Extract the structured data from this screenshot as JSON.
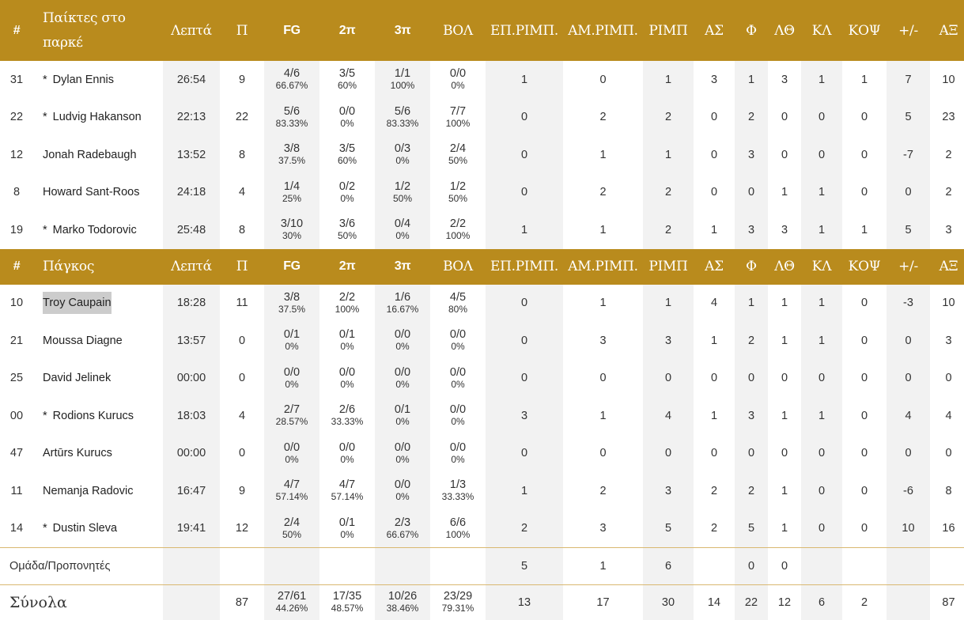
{
  "headers": {
    "starters": [
      "#",
      "Παίκτες στο παρκέ",
      "Λεπτά",
      "Π",
      "FG",
      "2π",
      "3π",
      "ΒΟΛ",
      "ΕΠ.ΡΙΜΠ.",
      "ΑΜ.ΡΙΜΠ.",
      "ΡΙΜΠ",
      "ΑΣ",
      "Φ",
      "ΛΘ",
      "ΚΛ",
      "ΚΟΨ",
      "+/-",
      "ΑΞ"
    ],
    "bench": [
      "#",
      "Πάγκος",
      "Λεπτά",
      "Π",
      "FG",
      "2π",
      "3π",
      "ΒΟΛ",
      "ΕΠ.ΡΙΜΠ.",
      "ΑΜ.ΡΙΜΠ.",
      "ΡΙΜΠ",
      "ΑΣ",
      "Φ",
      "ΛΘ",
      "ΚΛ",
      "ΚΟΨ",
      "+/-",
      "ΑΞ"
    ]
  },
  "starters": [
    {
      "num": "31",
      "star": "*",
      "name": "Dylan Ennis",
      "min": "26:54",
      "pts": "9",
      "fg": "4/6",
      "fg_pct": "66.67%",
      "p2": "3/5",
      "p2_pct": "60%",
      "p3": "1/1",
      "p3_pct": "100%",
      "ft": "0/0",
      "ft_pct": "0%",
      "or": "1",
      "dr": "0",
      "tr": "1",
      "as": "3",
      "f": "1",
      "lt": "3",
      "kl": "1",
      "kop": "1",
      "pm": "7",
      "ax": "10"
    },
    {
      "num": "22",
      "star": "*",
      "name": "Ludvig Hakanson",
      "min": "22:13",
      "pts": "22",
      "fg": "5/6",
      "fg_pct": "83.33%",
      "p2": "0/0",
      "p2_pct": "0%",
      "p3": "5/6",
      "p3_pct": "83.33%",
      "ft": "7/7",
      "ft_pct": "100%",
      "or": "0",
      "dr": "2",
      "tr": "2",
      "as": "0",
      "f": "2",
      "lt": "0",
      "kl": "0",
      "kop": "0",
      "pm": "5",
      "ax": "23"
    },
    {
      "num": "12",
      "star": "",
      "name": "Jonah Radebaugh",
      "min": "13:52",
      "pts": "8",
      "fg": "3/8",
      "fg_pct": "37.5%",
      "p2": "3/5",
      "p2_pct": "60%",
      "p3": "0/3",
      "p3_pct": "0%",
      "ft": "2/4",
      "ft_pct": "50%",
      "or": "0",
      "dr": "1",
      "tr": "1",
      "as": "0",
      "f": "3",
      "lt": "0",
      "kl": "0",
      "kop": "0",
      "pm": "-7",
      "ax": "2"
    },
    {
      "num": "8",
      "star": "",
      "name": "Howard Sant-Roos",
      "min": "24:18",
      "pts": "4",
      "fg": "1/4",
      "fg_pct": "25%",
      "p2": "0/2",
      "p2_pct": "0%",
      "p3": "1/2",
      "p3_pct": "50%",
      "ft": "1/2",
      "ft_pct": "50%",
      "or": "0",
      "dr": "2",
      "tr": "2",
      "as": "0",
      "f": "0",
      "lt": "1",
      "kl": "1",
      "kop": "0",
      "pm": "0",
      "ax": "2"
    },
    {
      "num": "19",
      "star": "*",
      "name": "Marko Todorovic",
      "min": "25:48",
      "pts": "8",
      "fg": "3/10",
      "fg_pct": "30%",
      "p2": "3/6",
      "p2_pct": "50%",
      "p3": "0/4",
      "p3_pct": "0%",
      "ft": "2/2",
      "ft_pct": "100%",
      "or": "1",
      "dr": "1",
      "tr": "2",
      "as": "1",
      "f": "3",
      "lt": "3",
      "kl": "1",
      "kop": "1",
      "pm": "5",
      "ax": "3"
    }
  ],
  "bench": [
    {
      "num": "10",
      "star": "",
      "name": "Troy Caupain",
      "highlight": true,
      "min": "18:28",
      "pts": "11",
      "fg": "3/8",
      "fg_pct": "37.5%",
      "p2": "2/2",
      "p2_pct": "100%",
      "p3": "1/6",
      "p3_pct": "16.67%",
      "ft": "4/5",
      "ft_pct": "80%",
      "or": "0",
      "dr": "1",
      "tr": "1",
      "as": "4",
      "f": "1",
      "lt": "1",
      "kl": "1",
      "kop": "0",
      "pm": "-3",
      "ax": "10"
    },
    {
      "num": "21",
      "star": "",
      "name": "Moussa Diagne",
      "min": "13:57",
      "pts": "0",
      "fg": "0/1",
      "fg_pct": "0%",
      "p2": "0/1",
      "p2_pct": "0%",
      "p3": "0/0",
      "p3_pct": "0%",
      "ft": "0/0",
      "ft_pct": "0%",
      "or": "0",
      "dr": "3",
      "tr": "3",
      "as": "1",
      "f": "2",
      "lt": "1",
      "kl": "1",
      "kop": "0",
      "pm": "0",
      "ax": "3"
    },
    {
      "num": "25",
      "star": "",
      "name": "David Jelinek",
      "min": "00:00",
      "pts": "0",
      "fg": "0/0",
      "fg_pct": "0%",
      "p2": "0/0",
      "p2_pct": "0%",
      "p3": "0/0",
      "p3_pct": "0%",
      "ft": "0/0",
      "ft_pct": "0%",
      "or": "0",
      "dr": "0",
      "tr": "0",
      "as": "0",
      "f": "0",
      "lt": "0",
      "kl": "0",
      "kop": "0",
      "pm": "0",
      "ax": "0"
    },
    {
      "num": "00",
      "star": "*",
      "name": "Rodions Kurucs",
      "min": "18:03",
      "pts": "4",
      "fg": "2/7",
      "fg_pct": "28.57%",
      "p2": "2/6",
      "p2_pct": "33.33%",
      "p3": "0/1",
      "p3_pct": "0%",
      "ft": "0/0",
      "ft_pct": "0%",
      "or": "3",
      "dr": "1",
      "tr": "4",
      "as": "1",
      "f": "3",
      "lt": "1",
      "kl": "1",
      "kop": "0",
      "pm": "4",
      "ax": "4"
    },
    {
      "num": "47",
      "star": "",
      "name": "Artūrs Kurucs",
      "min": "00:00",
      "pts": "0",
      "fg": "0/0",
      "fg_pct": "0%",
      "p2": "0/0",
      "p2_pct": "0%",
      "p3": "0/0",
      "p3_pct": "0%",
      "ft": "0/0",
      "ft_pct": "0%",
      "or": "0",
      "dr": "0",
      "tr": "0",
      "as": "0",
      "f": "0",
      "lt": "0",
      "kl": "0",
      "kop": "0",
      "pm": "0",
      "ax": "0"
    },
    {
      "num": "11",
      "star": "",
      "name": "Nemanja Radovic",
      "min": "16:47",
      "pts": "9",
      "fg": "4/7",
      "fg_pct": "57.14%",
      "p2": "4/7",
      "p2_pct": "57.14%",
      "p3": "0/0",
      "p3_pct": "0%",
      "ft": "1/3",
      "ft_pct": "33.33%",
      "or": "1",
      "dr": "2",
      "tr": "3",
      "as": "2",
      "f": "2",
      "lt": "1",
      "kl": "0",
      "kop": "0",
      "pm": "-6",
      "ax": "8"
    },
    {
      "num": "14",
      "star": "*",
      "name": "Dustin Sleva",
      "min": "19:41",
      "pts": "12",
      "fg": "2/4",
      "fg_pct": "50%",
      "p2": "0/1",
      "p2_pct": "0%",
      "p3": "2/3",
      "p3_pct": "66.67%",
      "ft": "6/6",
      "ft_pct": "100%",
      "or": "2",
      "dr": "3",
      "tr": "5",
      "as": "2",
      "f": "5",
      "lt": "1",
      "kl": "0",
      "kop": "0",
      "pm": "10",
      "ax": "16"
    }
  ],
  "team": {
    "label": "Ομάδα/Προπονητές",
    "or": "5",
    "dr": "1",
    "tr": "6",
    "f": "0",
    "lt": "0"
  },
  "totals": {
    "label": "Σύνολα",
    "pts": "87",
    "fg": "27/61",
    "fg_pct": "44.26%",
    "p2": "17/35",
    "p2_pct": "48.57%",
    "p3": "10/26",
    "p3_pct": "38.46%",
    "ft": "23/29",
    "ft_pct": "79.31%",
    "or": "13",
    "dr": "17",
    "tr": "30",
    "as": "14",
    "f": "22",
    "lt": "12",
    "kl": "6",
    "kop": "2",
    "ax": "87"
  }
}
